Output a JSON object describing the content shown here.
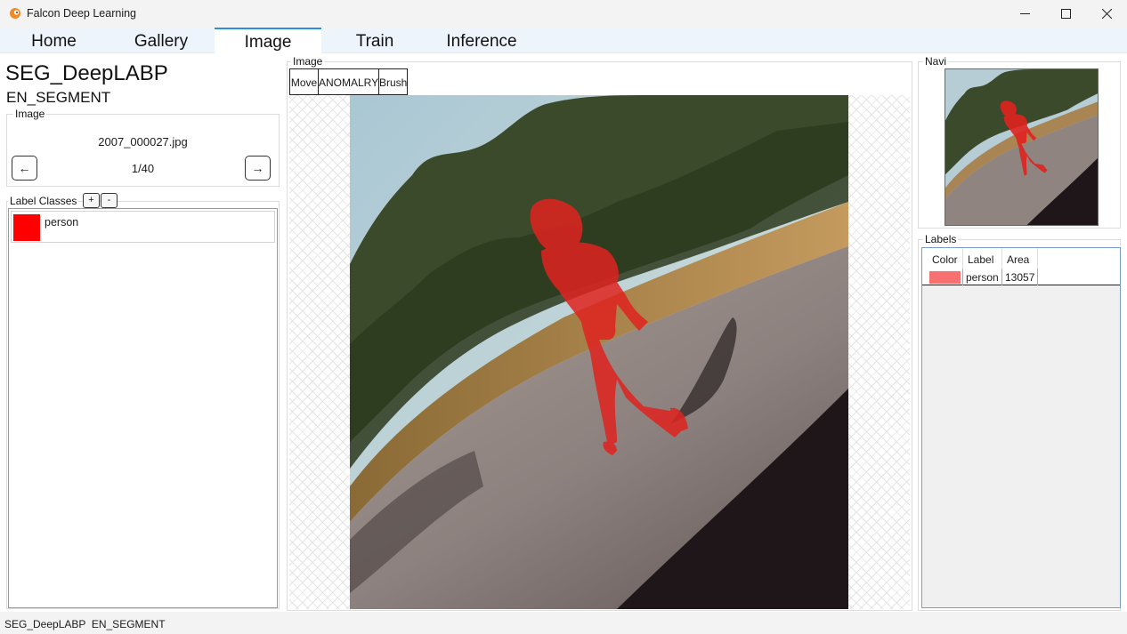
{
  "window": {
    "title": "Falcon Deep Learning"
  },
  "tabs": [
    {
      "label": "Home"
    },
    {
      "label": "Gallery"
    },
    {
      "label": "Image",
      "active": true
    },
    {
      "label": "Train"
    },
    {
      "label": "Inference"
    }
  ],
  "project": {
    "name": "SEG_DeepLABP",
    "type": "EN_SEGMENT"
  },
  "image_panel": {
    "legend": "Image",
    "file_name": "2007_000027.jpg",
    "counter": "1/40",
    "prev_label": "←",
    "next_label": "→"
  },
  "label_classes": {
    "legend": "Label Classes",
    "add_label": "+",
    "remove_label": "-",
    "items": [
      {
        "name": "person",
        "color": "#ff0000"
      }
    ]
  },
  "viewer": {
    "legend": "Image",
    "tools": [
      {
        "label": "Move"
      },
      {
        "label": "ANOMALRY"
      },
      {
        "label": "Brush"
      }
    ]
  },
  "navi": {
    "legend": "Navi"
  },
  "labels": {
    "legend": "Labels",
    "columns": [
      "Color",
      "Label",
      "Area"
    ],
    "rows": [
      {
        "color": "#f87171",
        "label": "person",
        "area": "13057"
      }
    ]
  },
  "status": {
    "text": "SEG_DeepLABP  EN_SEGMENT"
  },
  "colors": {
    "accent": "#2a8fe0",
    "mask": "#ff0000"
  },
  "icons": [
    "falcon-app-icon",
    "minimize-icon",
    "maximize-icon",
    "close-icon"
  ]
}
